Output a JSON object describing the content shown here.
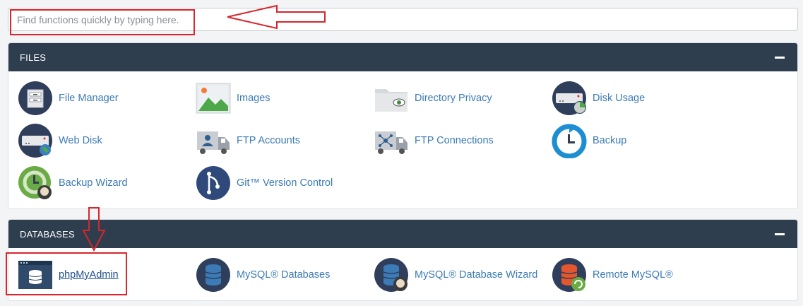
{
  "search": {
    "placeholder": "Find functions quickly by typing here."
  },
  "files": {
    "title": "FILES",
    "items": [
      {
        "label": "File Manager",
        "icon": "file-manager-icon"
      },
      {
        "label": "Images",
        "icon": "images-icon"
      },
      {
        "label": "Directory Privacy",
        "icon": "directory-privacy-icon"
      },
      {
        "label": "Disk Usage",
        "icon": "disk-usage-icon"
      },
      {
        "label": "Web Disk",
        "icon": "web-disk-icon"
      },
      {
        "label": "FTP Accounts",
        "icon": "ftp-accounts-icon"
      },
      {
        "label": "FTP Connections",
        "icon": "ftp-connections-icon"
      },
      {
        "label": "Backup",
        "icon": "backup-icon"
      },
      {
        "label": "Backup Wizard",
        "icon": "backup-wizard-icon"
      },
      {
        "label": "Git™ Version Control",
        "icon": "git-version-control-icon"
      }
    ]
  },
  "databases": {
    "title": "DATABASES",
    "items": [
      {
        "label": "phpMyAdmin",
        "icon": "phpmyadmin-icon"
      },
      {
        "label": "MySQL® Databases",
        "icon": "mysql-databases-icon"
      },
      {
        "label": "MySQL® Database Wizard",
        "icon": "mysql-database-wizard-icon"
      },
      {
        "label": "Remote MySQL®",
        "icon": "remote-mysql-icon"
      }
    ]
  },
  "colors": {
    "header_bg": "#2f3e4e",
    "link": "#3c7bb6",
    "annotation_red": "#d7262d"
  }
}
